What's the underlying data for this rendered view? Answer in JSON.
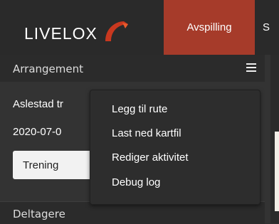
{
  "header": {
    "logo_text": "LIVELOX",
    "tabs": [
      {
        "label": "Avspilling",
        "active": true
      },
      {
        "label": "S",
        "active": false
      }
    ],
    "accent_color": "#a63b2a"
  },
  "sidebar": {
    "header_title": "Arrangement",
    "menu_icon": "hamburger-icon",
    "event_name": "Aslestad tr",
    "event_date": "2020-07-0",
    "selected_class": "Trening",
    "section_title": "Deltagere"
  },
  "context_menu": {
    "items": [
      {
        "label": "Legg til rute"
      },
      {
        "label": "Last ned kartfil"
      },
      {
        "label": "Rediger aktivitet"
      },
      {
        "label": "Debug log"
      }
    ]
  }
}
